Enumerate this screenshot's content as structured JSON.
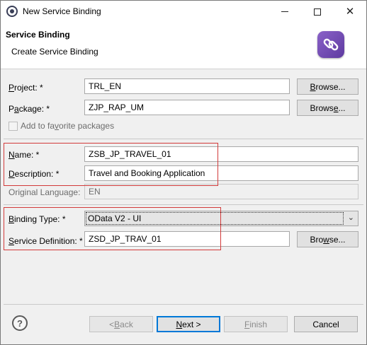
{
  "window": {
    "title": "New Service Binding"
  },
  "banner": {
    "title": "Service Binding",
    "subtitle": "Create Service Binding",
    "icon": "service-binding-link-icon"
  },
  "form": {
    "project": {
      "label_u": "P",
      "label_rest": "roject: *",
      "value": "TRL_EN",
      "browse": {
        "u": "B",
        "rest": "rowse..."
      }
    },
    "package": {
      "label_pre": "P",
      "label_u": "a",
      "label_rest": "ckage: *",
      "value": "ZJP_RAP_UM",
      "browse": {
        "pre": "Brows",
        "u": "e",
        "rest": "..."
      }
    },
    "favorites": {
      "pre": "Add to fa",
      "u": "v",
      "rest": "orite packages"
    },
    "name": {
      "label_u": "N",
      "label_rest": "ame: *",
      "value": "ZSB_JP_TRAVEL_01"
    },
    "description": {
      "label_u": "D",
      "label_rest": "escription: *",
      "value": "Travel and Booking Application"
    },
    "original_language": {
      "label": "Original Language:",
      "value": "EN"
    },
    "binding_type": {
      "label_u": "B",
      "label_rest": "inding Type: *",
      "value": "OData V2 - UI"
    },
    "service_definition": {
      "label_u": "S",
      "label_rest": "ervice Definition: *",
      "value": "ZSD_JP_TRAV_01",
      "browse": {
        "pre": "Bro",
        "u": "w",
        "rest": "se..."
      }
    }
  },
  "footer": {
    "help_icon": "?",
    "back": {
      "pre": "< ",
      "u": "B",
      "rest": "ack"
    },
    "next": {
      "u": "N",
      "rest": "ext >"
    },
    "finish": {
      "u": "F",
      "rest": "inish"
    },
    "cancel": "Cancel"
  },
  "colors": {
    "highlight_border": "#d23a3a",
    "default_button_border": "#0078d7",
    "banner_icon": "#6f48b5"
  }
}
